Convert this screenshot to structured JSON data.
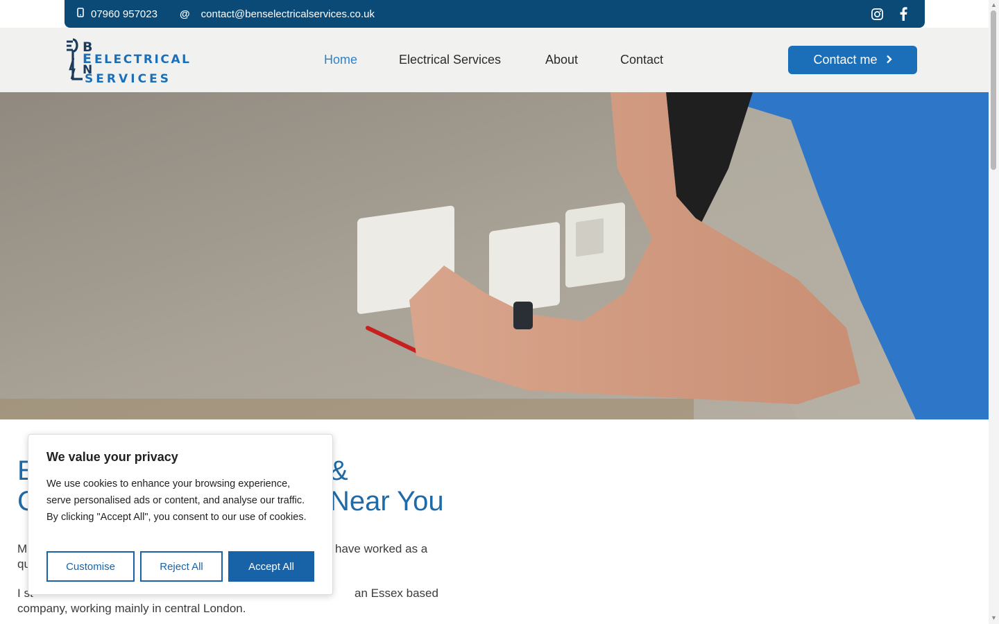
{
  "topbar": {
    "phone": "07960 957023",
    "email": "contact@benselectricalservices.co.uk",
    "phone_icon": "phone-icon",
    "email_icon": "at-icon",
    "social": [
      "instagram-icon",
      "facebook-icon"
    ]
  },
  "header": {
    "logo": {
      "line1": "ELECTRICAL",
      "line2": "SERVICES",
      "letters": [
        "B",
        "E",
        "N",
        "S"
      ]
    },
    "nav": [
      "Home",
      "Electrical Services",
      "About",
      "Contact"
    ],
    "active": "Home",
    "cta_label": "Contact me"
  },
  "hero": {
    "alt": "Electrician testing a wall socket"
  },
  "content": {
    "heading_line1_start": "E",
    "heading_line1_end": "&",
    "heading_line2_start": "C",
    "heading_line2_end": "Near You",
    "para1_start": "M",
    "para1_end": "have worked as a",
    "para1_line2": "qu",
    "para2_start": "I st",
    "para2_end": "an Essex based",
    "para2_line2": "company, working mainly in central London."
  },
  "cookie": {
    "title": "We value your privacy",
    "text": "We use cookies to enhance your browsing experience, serve personalised ads or content, and analyse our traffic. By clicking \"Accept All\", you consent to our use of cookies.",
    "customise": "Customise",
    "reject": "Reject All",
    "accept": "Accept All"
  },
  "colors": {
    "topbar": "#0b4a77",
    "accent": "#1a6fb8",
    "nav_active": "#2d82c9",
    "heading": "#1f6aa8"
  }
}
